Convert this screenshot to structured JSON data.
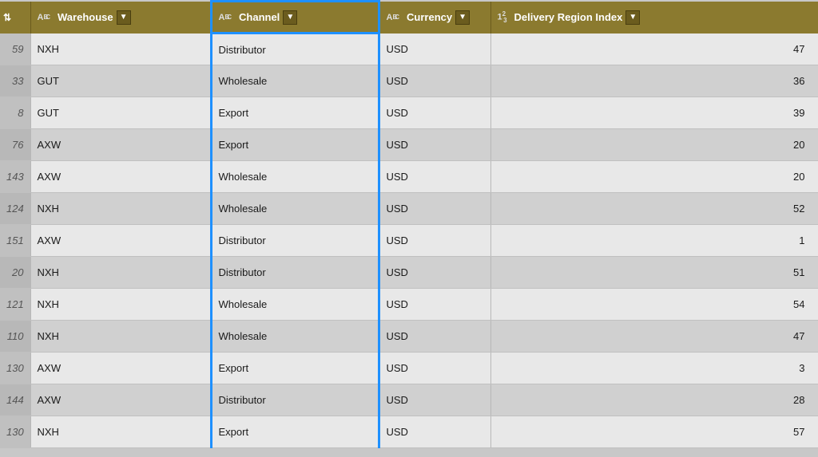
{
  "header": {
    "index_label": "",
    "warehouse_label": "Warehouse",
    "channel_label": "Channel",
    "currency_label": "Currency",
    "delivery_label": "Delivery Region Index"
  },
  "rows": [
    {
      "index": 59,
      "warehouse": "NXH",
      "channel": "Distributor",
      "currency": "USD",
      "delivery": 47
    },
    {
      "index": 33,
      "warehouse": "GUT",
      "channel": "Wholesale",
      "currency": "USD",
      "delivery": 36
    },
    {
      "index": 8,
      "warehouse": "GUT",
      "channel": "Export",
      "currency": "USD",
      "delivery": 39
    },
    {
      "index": 76,
      "warehouse": "AXW",
      "channel": "Export",
      "currency": "USD",
      "delivery": 20
    },
    {
      "index": 143,
      "warehouse": "AXW",
      "channel": "Wholesale",
      "currency": "USD",
      "delivery": 20
    },
    {
      "index": 124,
      "warehouse": "NXH",
      "channel": "Wholesale",
      "currency": "USD",
      "delivery": 52
    },
    {
      "index": 151,
      "warehouse": "AXW",
      "channel": "Distributor",
      "currency": "USD",
      "delivery": 1
    },
    {
      "index": 20,
      "warehouse": "NXH",
      "channel": "Distributor",
      "currency": "USD",
      "delivery": 51
    },
    {
      "index": 121,
      "warehouse": "NXH",
      "channel": "Wholesale",
      "currency": "USD",
      "delivery": 54
    },
    {
      "index": 110,
      "warehouse": "NXH",
      "channel": "Wholesale",
      "currency": "USD",
      "delivery": 47
    },
    {
      "index": 130,
      "warehouse": "AXW",
      "channel": "Export",
      "currency": "USD",
      "delivery": 3
    },
    {
      "index": 144,
      "warehouse": "AXW",
      "channel": "Distributor",
      "currency": "USD",
      "delivery": 28
    },
    {
      "index": 130,
      "warehouse": "NXH",
      "channel": "Export",
      "currency": "USD",
      "delivery": 57
    }
  ]
}
